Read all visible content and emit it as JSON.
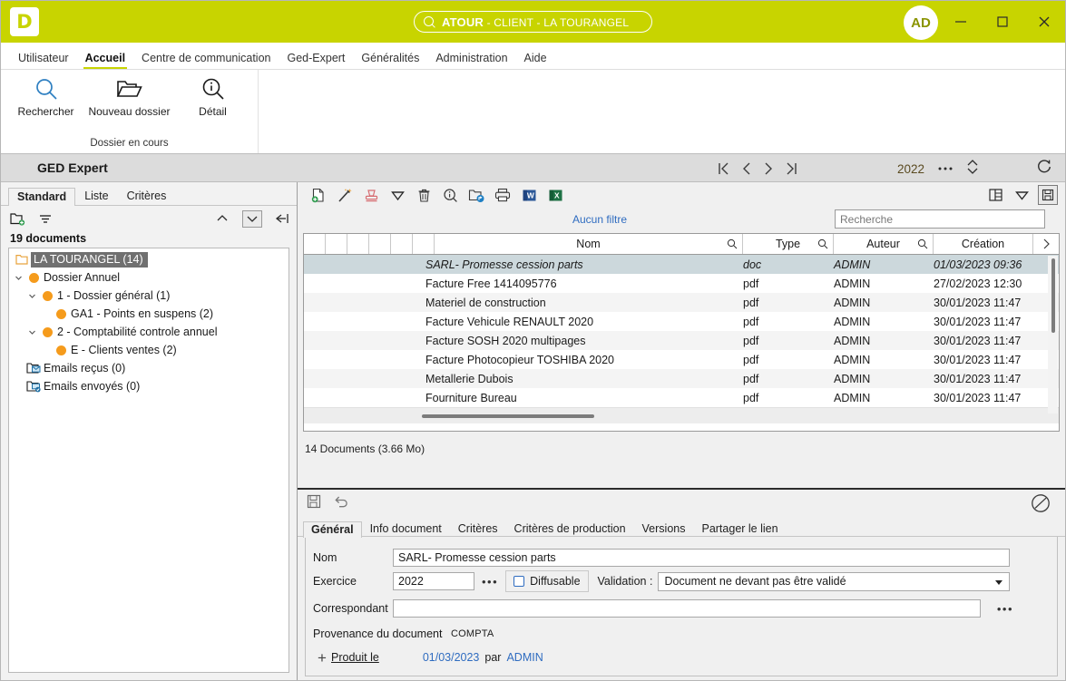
{
  "titlebar": {
    "logo": "D",
    "search_text_main": "ATOUR",
    "search_text_rest": " - CLIENT - LA TOURANGEL",
    "avatar_initials": "AD",
    "minimize_icon": "minimize-icon",
    "maximize_icon": "maximize-icon",
    "close_icon": "close-icon",
    "accent_color": "#c8d400"
  },
  "menubar": {
    "items": [
      {
        "label": "Utilisateur",
        "active": false
      },
      {
        "label": "Accueil",
        "active": true
      },
      {
        "label": "Centre de communication",
        "active": false
      },
      {
        "label": "Ged-Expert",
        "active": false
      },
      {
        "label": "Généralités",
        "active": false
      },
      {
        "label": "Administration",
        "active": false
      },
      {
        "label": "Aide",
        "active": false
      }
    ]
  },
  "ribbon": {
    "group_label": "Dossier en cours",
    "buttons": [
      {
        "label": "Rechercher",
        "icon": "search-icon"
      },
      {
        "label": "Nouveau dossier",
        "icon": "new-folder-icon"
      },
      {
        "label": "Détail",
        "icon": "info-search-icon"
      }
    ]
  },
  "section": {
    "title": "GED Expert",
    "year": "2022",
    "nav_first": "first-record-icon",
    "nav_prev": "previous-record-icon",
    "nav_next": "next-record-icon",
    "nav_last": "last-record-icon",
    "ellipsis": "…",
    "updown_icon": "up-down-spinner-icon",
    "refresh_icon": "refresh-icon"
  },
  "left_panel": {
    "tabs": [
      {
        "label": "Standard",
        "active": true
      },
      {
        "label": "Liste",
        "active": false
      },
      {
        "label": "Critères",
        "active": false
      }
    ],
    "toolbar": {
      "new_folder_icon": "new-folder-icon",
      "filter_icon": "filter-icon",
      "collapse_icon": "chevron-up-icon",
      "expand_icon": "chevron-down-icon",
      "back_icon": "collapse-left-icon"
    },
    "doc_count": "19 documents",
    "tree": [
      {
        "label": "LA TOURANGEL  (14)",
        "depth": 0,
        "icon": "folder-icon",
        "selected": true,
        "twist": ""
      },
      {
        "label": "Dossier Annuel",
        "depth": 1,
        "icon": "orange-dot",
        "selected": false,
        "twist": "v"
      },
      {
        "label": "1 - Dossier général (1)",
        "depth": 2,
        "icon": "orange-dot",
        "selected": false,
        "twist": "v"
      },
      {
        "label": "GA1 - Points en suspens (2)",
        "depth": 3,
        "icon": "orange-dot",
        "selected": false,
        "twist": ""
      },
      {
        "label": "2 - Comptabilité controle annuel",
        "depth": 2,
        "icon": "orange-dot",
        "selected": false,
        "twist": "v"
      },
      {
        "label": "E - Clients ventes (2)",
        "depth": 3,
        "icon": "orange-dot",
        "selected": false,
        "twist": ""
      },
      {
        "label": "Emails reçus (0)",
        "depth": 1,
        "icon": "mail-received-icon",
        "selected": false,
        "twist": ""
      },
      {
        "label": "Emails envoyés (0)",
        "depth": 1,
        "icon": "mail-sent-icon",
        "selected": false,
        "twist": ""
      }
    ]
  },
  "doc_toolbar": {
    "icons": [
      "add-document-icon",
      "edit-wand-icon",
      "stamp-icon",
      "filter-funnel-icon",
      "delete-trash-icon",
      "info-search-icon",
      "move-folder-icon",
      "print-icon",
      "word-export-icon",
      "excel-export-icon"
    ],
    "right_icons": [
      "layout-columns-icon",
      "filter-funnel-icon",
      "save-layout-icon"
    ]
  },
  "grid": {
    "filter_label": "Aucun filtre",
    "search_placeholder": "Recherche",
    "columns": [
      "Nom",
      "Type",
      "Auteur",
      "Création"
    ],
    "rows": [
      {
        "nom": "SARL- Promesse cession parts",
        "type": "doc",
        "auteur": "ADMIN",
        "creation": "01/03/2023 09:36",
        "selected": true
      },
      {
        "nom": "Facture Free 1414095776",
        "type": "pdf",
        "auteur": "ADMIN",
        "creation": "27/02/2023 12:30",
        "selected": false
      },
      {
        "nom": "Materiel de construction",
        "type": "pdf",
        "auteur": "ADMIN",
        "creation": "30/01/2023 11:47",
        "selected": false
      },
      {
        "nom": "Facture Vehicule RENAULT 2020",
        "type": "pdf",
        "auteur": "ADMIN",
        "creation": "30/01/2023 11:47",
        "selected": false
      },
      {
        "nom": "Facture SOSH 2020 multipages",
        "type": "pdf",
        "auteur": "ADMIN",
        "creation": "30/01/2023 11:47",
        "selected": false
      },
      {
        "nom": "Facture Photocopieur TOSHIBA 2020",
        "type": "pdf",
        "auteur": "ADMIN",
        "creation": "30/01/2023 11:47",
        "selected": false
      },
      {
        "nom": "Metallerie Dubois",
        "type": "pdf",
        "auteur": "ADMIN",
        "creation": "30/01/2023 11:47",
        "selected": false
      },
      {
        "nom": "Fourniture Bureau",
        "type": "pdf",
        "auteur": "ADMIN",
        "creation": "30/01/2023 11:47",
        "selected": false
      }
    ],
    "summary": "14 Documents (3.66 Mo)"
  },
  "detail": {
    "save_icon": "save-icon",
    "undo_icon": "undo-icon",
    "forbidden_icon": "no-entry-icon",
    "tabs": [
      {
        "label": "Général",
        "active": true
      },
      {
        "label": "Info document",
        "active": false
      },
      {
        "label": "Critères",
        "active": false
      },
      {
        "label": "Critères de production",
        "active": false
      },
      {
        "label": "Versions",
        "active": false
      },
      {
        "label": "Partager le lien",
        "active": false
      }
    ],
    "form": {
      "nom_label": "Nom",
      "nom_value": "SARL- Promesse cession parts",
      "exercice_label": "Exercice",
      "exercice_value": "2022",
      "diffusable_label": "Diffusable",
      "validation_label": "Validation :",
      "validation_value": "Document ne devant pas être validé",
      "correspondant_label": "Correspondant",
      "correspondant_value": "",
      "provenance_label": "Provenance du document",
      "provenance_value": "COMPTA",
      "produit_label": "Produit le",
      "produit_date": "01/03/2023",
      "produit_par": "par",
      "produit_user": "ADMIN",
      "dots": "•••"
    }
  }
}
